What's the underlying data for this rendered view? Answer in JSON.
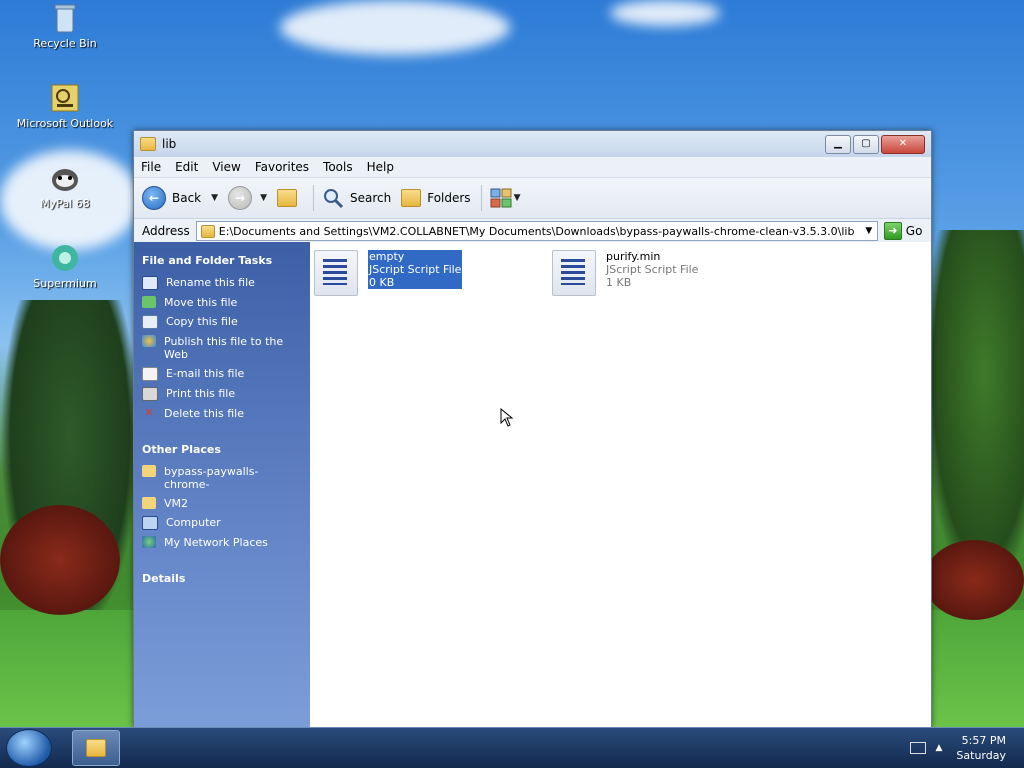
{
  "desktop": {
    "icons": [
      {
        "label": "Recycle Bin",
        "icon": "recycle-bin-icon"
      },
      {
        "label": "Microsoft Outlook",
        "icon": "outlook-icon"
      },
      {
        "label": "MyPal 68",
        "icon": "mypal-icon"
      },
      {
        "label": "Supermium",
        "icon": "supermium-icon"
      }
    ]
  },
  "window": {
    "title": "lib",
    "menu": [
      "File",
      "Edit",
      "View",
      "Favorites",
      "Tools",
      "Help"
    ],
    "toolbar": {
      "back_label": "Back",
      "search_label": "Search",
      "folders_label": "Folders"
    },
    "address": {
      "label": "Address",
      "value": "E:\\Documents and Settings\\VM2.COLLABNET\\My Documents\\Downloads\\bypass-paywalls-chrome-clean-v3.5.3.0\\lib",
      "go_label": "Go"
    },
    "taskpane": {
      "file_tasks_title": "File and Folder Tasks",
      "file_tasks": [
        "Rename this file",
        "Move this file",
        "Copy this file",
        "Publish this file to the Web",
        "E-mail this file",
        "Print this file",
        "Delete this file"
      ],
      "other_places_title": "Other Places",
      "other_places": [
        "bypass-paywalls-chrome-",
        "VM2",
        "Computer",
        "My Network Places"
      ],
      "details_title": "Details"
    },
    "files": [
      {
        "name": "empty",
        "type": "JScript Script File",
        "size": "0 KB",
        "selected": true
      },
      {
        "name": "purify.min",
        "type": "JScript Script File",
        "size": "1 KB",
        "selected": false
      }
    ]
  },
  "taskbar": {
    "clock_time": "5:57 PM",
    "clock_day": "Saturday"
  }
}
